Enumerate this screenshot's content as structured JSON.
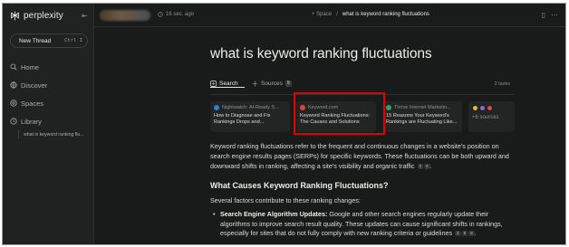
{
  "app": {
    "name": "perplexity"
  },
  "sidebar": {
    "new_thread_label": "New Thread",
    "new_thread_shortcut": "Ctrl I",
    "items": [
      {
        "label": "Home",
        "icon": "search-icon"
      },
      {
        "label": "Discover",
        "icon": "globe-icon"
      },
      {
        "label": "Spaces",
        "icon": "spaces-icon"
      },
      {
        "label": "Library",
        "icon": "library-icon"
      }
    ],
    "library_thread": "what is keyword ranking flu..."
  },
  "topbar": {
    "time_ago": "16 sec. ago",
    "space_label": "+ Space",
    "separator": "/",
    "thread_title": "what is keyword ranking fluctuations"
  },
  "main": {
    "title": "what is keyword ranking fluctuations",
    "tabs": [
      {
        "label": "Search",
        "icon": "search-tab-icon",
        "active": true
      },
      {
        "label": "Sources",
        "icon": "sources-icon",
        "badge": "9"
      }
    ],
    "tasks_label": "2 tasks",
    "sources": [
      {
        "site": "Nightwatch: AI-Ready S...",
        "title": "How to Diagnose and Fix Rankings Drops and...",
        "fav_color": "#3a7bd5"
      },
      {
        "site": "Keyword.com",
        "title": "Keyword Ranking Fluctuations: The Causes and Solutions",
        "fav_color": "#e04040"
      },
      {
        "site": "Thrive Internet Marketin...",
        "title": "15 Reasons Your Keyword's Rankings are Fluctuating Like...",
        "fav_color": "#2fa36b"
      }
    ],
    "more_sources": {
      "count": "+6",
      "label": "sources"
    },
    "answer": {
      "paragraph": "Keyword ranking fluctuations refer to the frequent and continuous changes in a website's position on search engine results pages (SERPs) for specific keywords. These fluctuations can be both upward and downward shifts in ranking, affecting a site's visibility and organic traffic",
      "paragraph_cites": [
        "2",
        "4"
      ],
      "heading": "What Causes Keyword Ranking Fluctuations?",
      "intro": "Several factors contribute to these ranking changes:",
      "bullet_title": "Search Engine Algorithm Updates:",
      "bullet_text": " Google and other search engines regularly update their algorithms to improve search result quality. These updates can cause significant shifts in rankings, especially for sites that do not fully comply with new ranking criteria or guidelines",
      "bullet_cites": [
        "2",
        "5",
        "8"
      ]
    }
  },
  "colors": {
    "highlight": "#e00000",
    "background": "#191a1a",
    "sidebar": "#202222"
  }
}
